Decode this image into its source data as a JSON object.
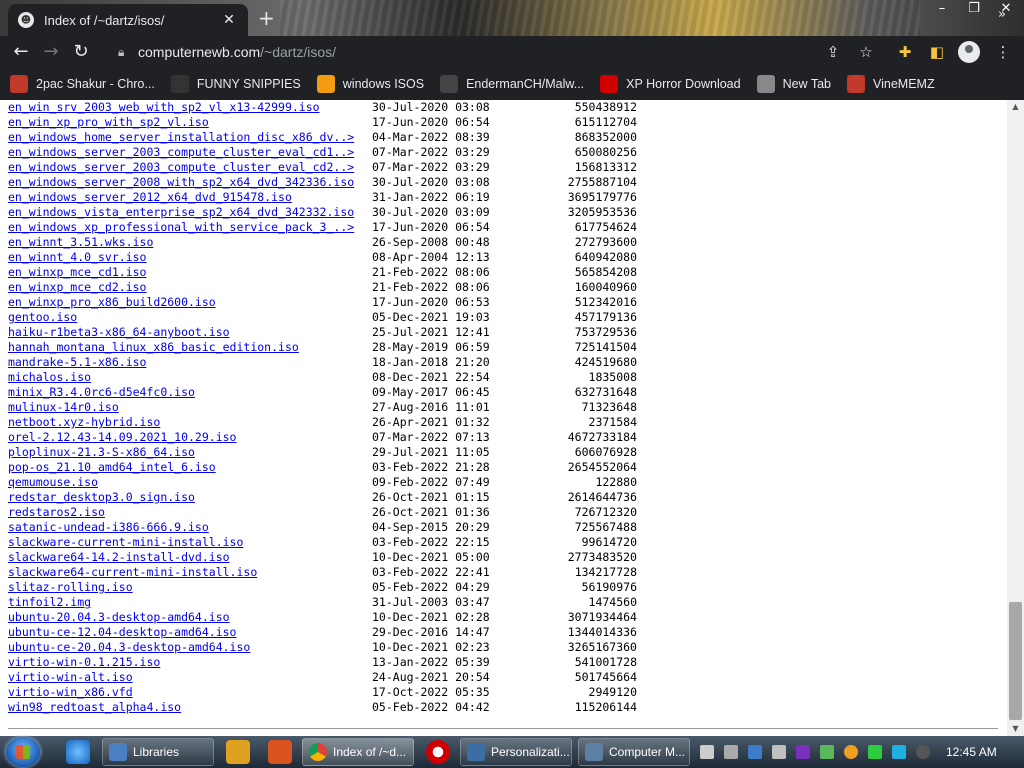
{
  "browser": {
    "tab_title": "Index of /~dartz/isos/",
    "url_host": "computernewb.com",
    "url_path": "/~dartz/isos/"
  },
  "bookmarks": [
    {
      "label": "2pac Shakur - Chro...",
      "icon": "music-icon",
      "color": "#c0392b"
    },
    {
      "label": "FUNNY SNIPPIES",
      "icon": "h-logo-icon",
      "color": "#333333"
    },
    {
      "label": "windows ISOS",
      "icon": "ph-logo-icon",
      "color": "#f39c12"
    },
    {
      "label": "EndermanCH/Malw...",
      "icon": "github-icon",
      "color": "#444444"
    },
    {
      "label": "XP Horror Download",
      "icon": "x-logo-icon",
      "color": "#d10000"
    },
    {
      "label": "New Tab",
      "icon": "chrome-icon",
      "color": "#888888"
    },
    {
      "label": "VineMEMZ",
      "icon": "r-logo-icon",
      "color": "#c0392b"
    }
  ],
  "files": [
    {
      "name": "en_win_srv_2003_web_with_sp2_vl_x13-42999.iso",
      "date": "30-Jul-2020 03:08",
      "size": "550438912"
    },
    {
      "name": "en_win_xp_pro_with_sp2_vl.iso",
      "date": "17-Jun-2020 06:54",
      "size": "615112704"
    },
    {
      "name": "en_windows_home_server_installation_disc_x86_dv..>",
      "date": "04-Mar-2022 08:39",
      "size": "868352000"
    },
    {
      "name": "en_windows_server_2003_compute_cluster_eval_cd1..>",
      "date": "07-Mar-2022 03:29",
      "size": "650080256"
    },
    {
      "name": "en_windows_server_2003_compute_cluster_eval_cd2..>",
      "date": "07-Mar-2022 03:29",
      "size": "156813312"
    },
    {
      "name": "en_windows_server_2008_with_sp2_x64_dvd_342336.iso",
      "date": "30-Jul-2020 03:08",
      "size": "2755887104"
    },
    {
      "name": "en_windows_server_2012_x64_dvd_915478.iso",
      "date": "31-Jan-2022 06:19",
      "size": "3695179776"
    },
    {
      "name": "en_windows_vista_enterprise_sp2_x64_dvd_342332.iso",
      "date": "30-Jul-2020 03:09",
      "size": "3205953536"
    },
    {
      "name": "en_windows_xp_professional_with_service_pack_3_..>",
      "date": "17-Jun-2020 06:54",
      "size": "617754624"
    },
    {
      "name": "en_winnt_3.51.wks.iso",
      "date": "26-Sep-2008 00:48",
      "size": "272793600"
    },
    {
      "name": "en_winnt_4.0_svr.iso",
      "date": "08-Apr-2004 12:13",
      "size": "640942080"
    },
    {
      "name": "en_winxp_mce_cd1.iso",
      "date": "21-Feb-2022 08:06",
      "size": "565854208"
    },
    {
      "name": "en_winxp_mce_cd2.iso",
      "date": "21-Feb-2022 08:06",
      "size": "160040960"
    },
    {
      "name": "en_winxp_pro_x86_build2600.iso",
      "date": "17-Jun-2020 06:53",
      "size": "512342016"
    },
    {
      "name": "gentoo.iso",
      "date": "05-Dec-2021 19:03",
      "size": "457179136"
    },
    {
      "name": "haiku-r1beta3-x86_64-anyboot.iso",
      "date": "25-Jul-2021 12:41",
      "size": "753729536"
    },
    {
      "name": "hannah_montana_linux_x86_basic_edition.iso",
      "date": "28-May-2019 06:59",
      "size": "725141504"
    },
    {
      "name": "mandrake-5.1-x86.iso",
      "date": "18-Jan-2018 21:20",
      "size": "424519680"
    },
    {
      "name": "michalos.iso",
      "date": "08-Dec-2021 22:54",
      "size": "1835008"
    },
    {
      "name": "minix_R3.4.0rc6-d5e4fc0.iso",
      "date": "09-May-2017 06:45",
      "size": "632731648"
    },
    {
      "name": "mulinux-14r0.iso",
      "date": "27-Aug-2016 11:01",
      "size": "71323648"
    },
    {
      "name": "netboot.xyz-hybrid.iso",
      "date": "26-Apr-2021 01:32",
      "size": "2371584"
    },
    {
      "name": "orel-2.12.43-14.09.2021_10.29.iso",
      "date": "07-Mar-2022 07:13",
      "size": "4672733184"
    },
    {
      "name": "ploplinux-21.3-S-x86_64.iso",
      "date": "29-Jul-2021 11:05",
      "size": "606076928"
    },
    {
      "name": "pop-os_21.10_amd64_intel_6.iso",
      "date": "03-Feb-2022 21:28",
      "size": "2654552064"
    },
    {
      "name": "qemumouse.iso",
      "date": "09-Feb-2022 07:49",
      "size": "122880"
    },
    {
      "name": "redstar_desktop3.0_sign.iso",
      "date": "26-Oct-2021 01:15",
      "size": "2614644736"
    },
    {
      "name": "redstaros2.iso",
      "date": "26-Oct-2021 01:36",
      "size": "726712320"
    },
    {
      "name": "satanic-undead-i386-666.9.iso",
      "date": "04-Sep-2015 20:29",
      "size": "725567488"
    },
    {
      "name": "slackware-current-mini-install.iso",
      "date": "03-Feb-2022 22:15",
      "size": "99614720"
    },
    {
      "name": "slackware64-14.2-install-dvd.iso",
      "date": "10-Dec-2021 05:00",
      "size": "2773483520"
    },
    {
      "name": "slackware64-current-mini-install.iso",
      "date": "03-Feb-2022 22:41",
      "size": "134217728"
    },
    {
      "name": "slitaz-rolling.iso",
      "date": "05-Feb-2022 04:29",
      "size": "56190976"
    },
    {
      "name": "tinfoil2.img",
      "date": "31-Jul-2003 03:47",
      "size": "1474560"
    },
    {
      "name": "ubuntu-20.04.3-desktop-amd64.iso",
      "date": "10-Dec-2021 02:28",
      "size": "3071934464"
    },
    {
      "name": "ubuntu-ce-12.04-desktop-amd64.iso",
      "date": "29-Dec-2016 14:47",
      "size": "1344014336"
    },
    {
      "name": "ubuntu-ce-20.04.3-desktop-amd64.iso",
      "date": "10-Dec-2021 02:23",
      "size": "3265167360"
    },
    {
      "name": "virtio-win-0.1.215.iso",
      "date": "13-Jan-2022 05:39",
      "size": "541001728"
    },
    {
      "name": "virtio-win-alt.iso",
      "date": "24-Aug-2021 20:54",
      "size": "501745664"
    },
    {
      "name": "virtio-win_x86.vfd",
      "date": "17-Oct-2022 05:35",
      "size": "2949120"
    },
    {
      "name": "win98_redtoast_alpha4.iso",
      "date": "05-Feb-2022 04:42",
      "size": "115206144"
    }
  ],
  "taskbar": {
    "libraries": "Libraries",
    "chrome": "Index of /~d...",
    "personalization": "Personalizati...",
    "computer": "Computer M...",
    "clock": "12:45 AM"
  }
}
